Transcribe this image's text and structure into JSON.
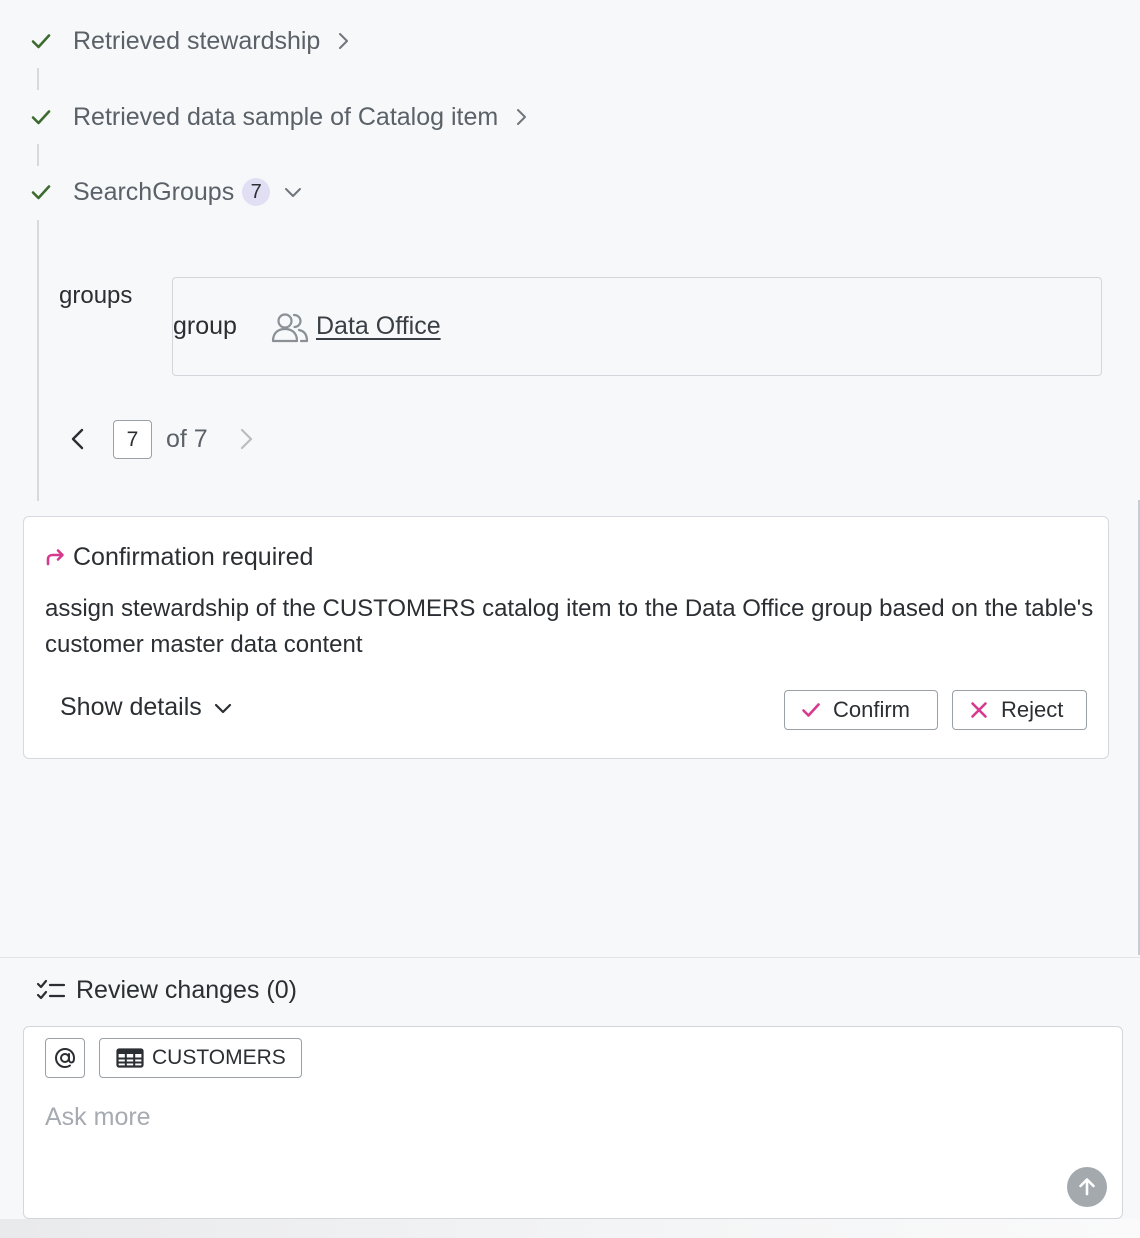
{
  "steps": [
    {
      "label": "Retrieved stewardship",
      "status_icon": "check-icon",
      "expand_icon": "chevron-right-icon"
    },
    {
      "label": "Retrieved data sample of Catalog item",
      "status_icon": "check-icon",
      "expand_icon": "chevron-right-icon"
    },
    {
      "label": "SearchGroups",
      "status_icon": "check-icon",
      "badge": "7",
      "expand_icon": "chevron-down-icon"
    }
  ],
  "result": {
    "field_label": "groups",
    "row": {
      "key": "group",
      "icon": "users-icon",
      "value": "Data Office"
    }
  },
  "pager": {
    "current": "7",
    "of_text": "of 7"
  },
  "confirmation": {
    "icon": "redirect-arrow-icon",
    "title": "Confirmation required",
    "message": "assign stewardship of the CUSTOMERS catalog item to the Data Office group based on the table's customer master data content",
    "show_details": "Show details",
    "confirm_label": "Confirm",
    "reject_label": "Reject"
  },
  "review": {
    "label": "Review changes (0)",
    "icon": "checklist-icon"
  },
  "composer": {
    "mention_icon": "at-icon",
    "context_chip": "CUSTOMERS",
    "context_icon": "table-icon",
    "placeholder": "Ask more",
    "send_icon": "arrow-up-icon"
  },
  "colors": {
    "accent": "#d63a8f",
    "check": "#3d6b2f",
    "badge_bg": "#e2dff5"
  }
}
